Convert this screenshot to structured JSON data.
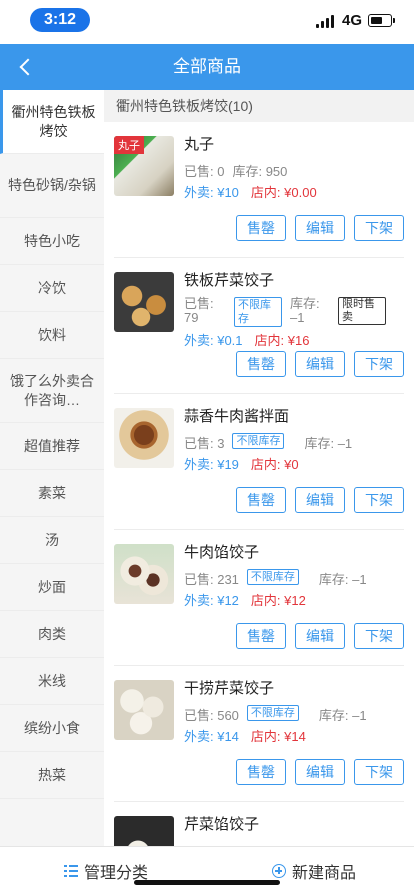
{
  "status": {
    "time": "3:12",
    "network": "4G"
  },
  "nav": {
    "title": "全部商品"
  },
  "sidebar": {
    "items": [
      {
        "label": "衢州特色铁板烤饺",
        "active": true
      },
      {
        "label": "特色砂锅/杂锅"
      },
      {
        "label": "特色小吃"
      },
      {
        "label": "冷饮"
      },
      {
        "label": "饮料"
      },
      {
        "label": "饿了么外卖合作咨询…"
      },
      {
        "label": "超值推荐"
      },
      {
        "label": "素菜"
      },
      {
        "label": "汤"
      },
      {
        "label": "炒面"
      },
      {
        "label": "肉类"
      },
      {
        "label": "米线"
      },
      {
        "label": "缤纷小食"
      },
      {
        "label": "热菜"
      }
    ]
  },
  "main": {
    "category_header": "衢州特色铁板烤饺(10)",
    "buttons": {
      "sold_out": "售罄",
      "edit": "编辑",
      "delist": "下架"
    },
    "products": [
      {
        "name": "丸子",
        "tag": "丸子",
        "sold": "已售: 0",
        "stock": "库存: 950",
        "price_out": "外卖: ¥10",
        "price_in": "店内: ¥0.00"
      },
      {
        "name": "铁板芹菜饺子",
        "sold": "已售: 79",
        "unlimited": "不限库存",
        "stock": "库存: –1",
        "limited": "限时售卖",
        "price_out": "外卖: ¥0.1",
        "price_in": "店内: ¥16"
      },
      {
        "name": "蒜香牛肉酱拌面",
        "sold": "已售: 3",
        "unlimited": "不限库存",
        "stock": "库存: –1",
        "price_out": "外卖: ¥19",
        "price_in": "店内: ¥0"
      },
      {
        "name": "牛肉馅饺子",
        "sold": "已售: 231",
        "unlimited": "不限库存",
        "stock": "库存: –1",
        "price_out": "外卖: ¥12",
        "price_in": "店内: ¥12"
      },
      {
        "name": "干捞芹菜饺子",
        "sold": "已售: 560",
        "unlimited": "不限库存",
        "stock": "库存: –1",
        "price_out": "外卖: ¥14",
        "price_in": "店内: ¥14"
      },
      {
        "name": "芹菜馅饺子"
      }
    ]
  },
  "bottom": {
    "manage": "管理分类",
    "create": "新建商品"
  },
  "colors": {
    "primary": "#3a97eb",
    "price_in": "#e2353b",
    "sidebar_bg": "#f5f5f5"
  }
}
